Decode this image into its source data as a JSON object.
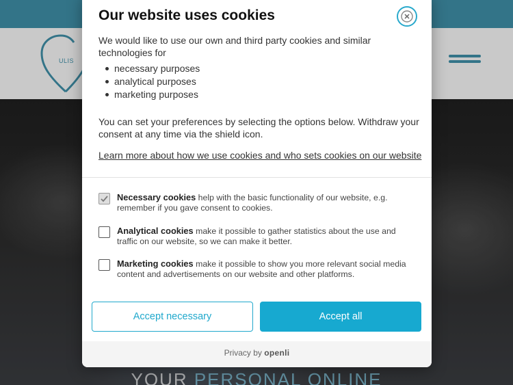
{
  "site": {
    "logo_text": "ULIS",
    "hero_title_part1": "YOUR ",
    "hero_title_part2": "PERSONAL ONLINE",
    "colors": {
      "topbar": "#3f8ea6",
      "header_bg": "#f6f6f6",
      "accent": "#3f8ea6"
    }
  },
  "modal": {
    "title": "Our website uses cookies",
    "intro": "We would like to use our own and third party cookies and similar technologies for",
    "purposes": [
      "necessary purposes",
      "analytical purposes",
      "marketing purposes"
    ],
    "preferences_text": "You can set your preferences by selecting the options below. Withdraw your consent at any time via the shield icon.",
    "learn_more_link": "Learn more about how we use cookies and who sets cookies on our website",
    "options": [
      {
        "name": "Necessary cookies",
        "description": " help with the basic functionality of our website, e.g. remember if you gave consent to cookies.",
        "checked": true,
        "disabled": true
      },
      {
        "name": "Analytical cookies",
        "description": " make it possible to gather statistics about the use and traffic on our website, so we can make it better.",
        "checked": false,
        "disabled": false
      },
      {
        "name": "Marketing cookies",
        "description": " make it possible to show you more relevant social media content and advertisements on our website and other platforms.",
        "checked": false,
        "disabled": false
      }
    ],
    "buttons": {
      "accept_necessary": "Accept necessary",
      "accept_all": "Accept all"
    },
    "footer": {
      "prefix": "Privacy by ",
      "brand": "openli"
    },
    "colors": {
      "primary": "#17a9d0",
      "close_ring": "#29a9cc"
    }
  }
}
